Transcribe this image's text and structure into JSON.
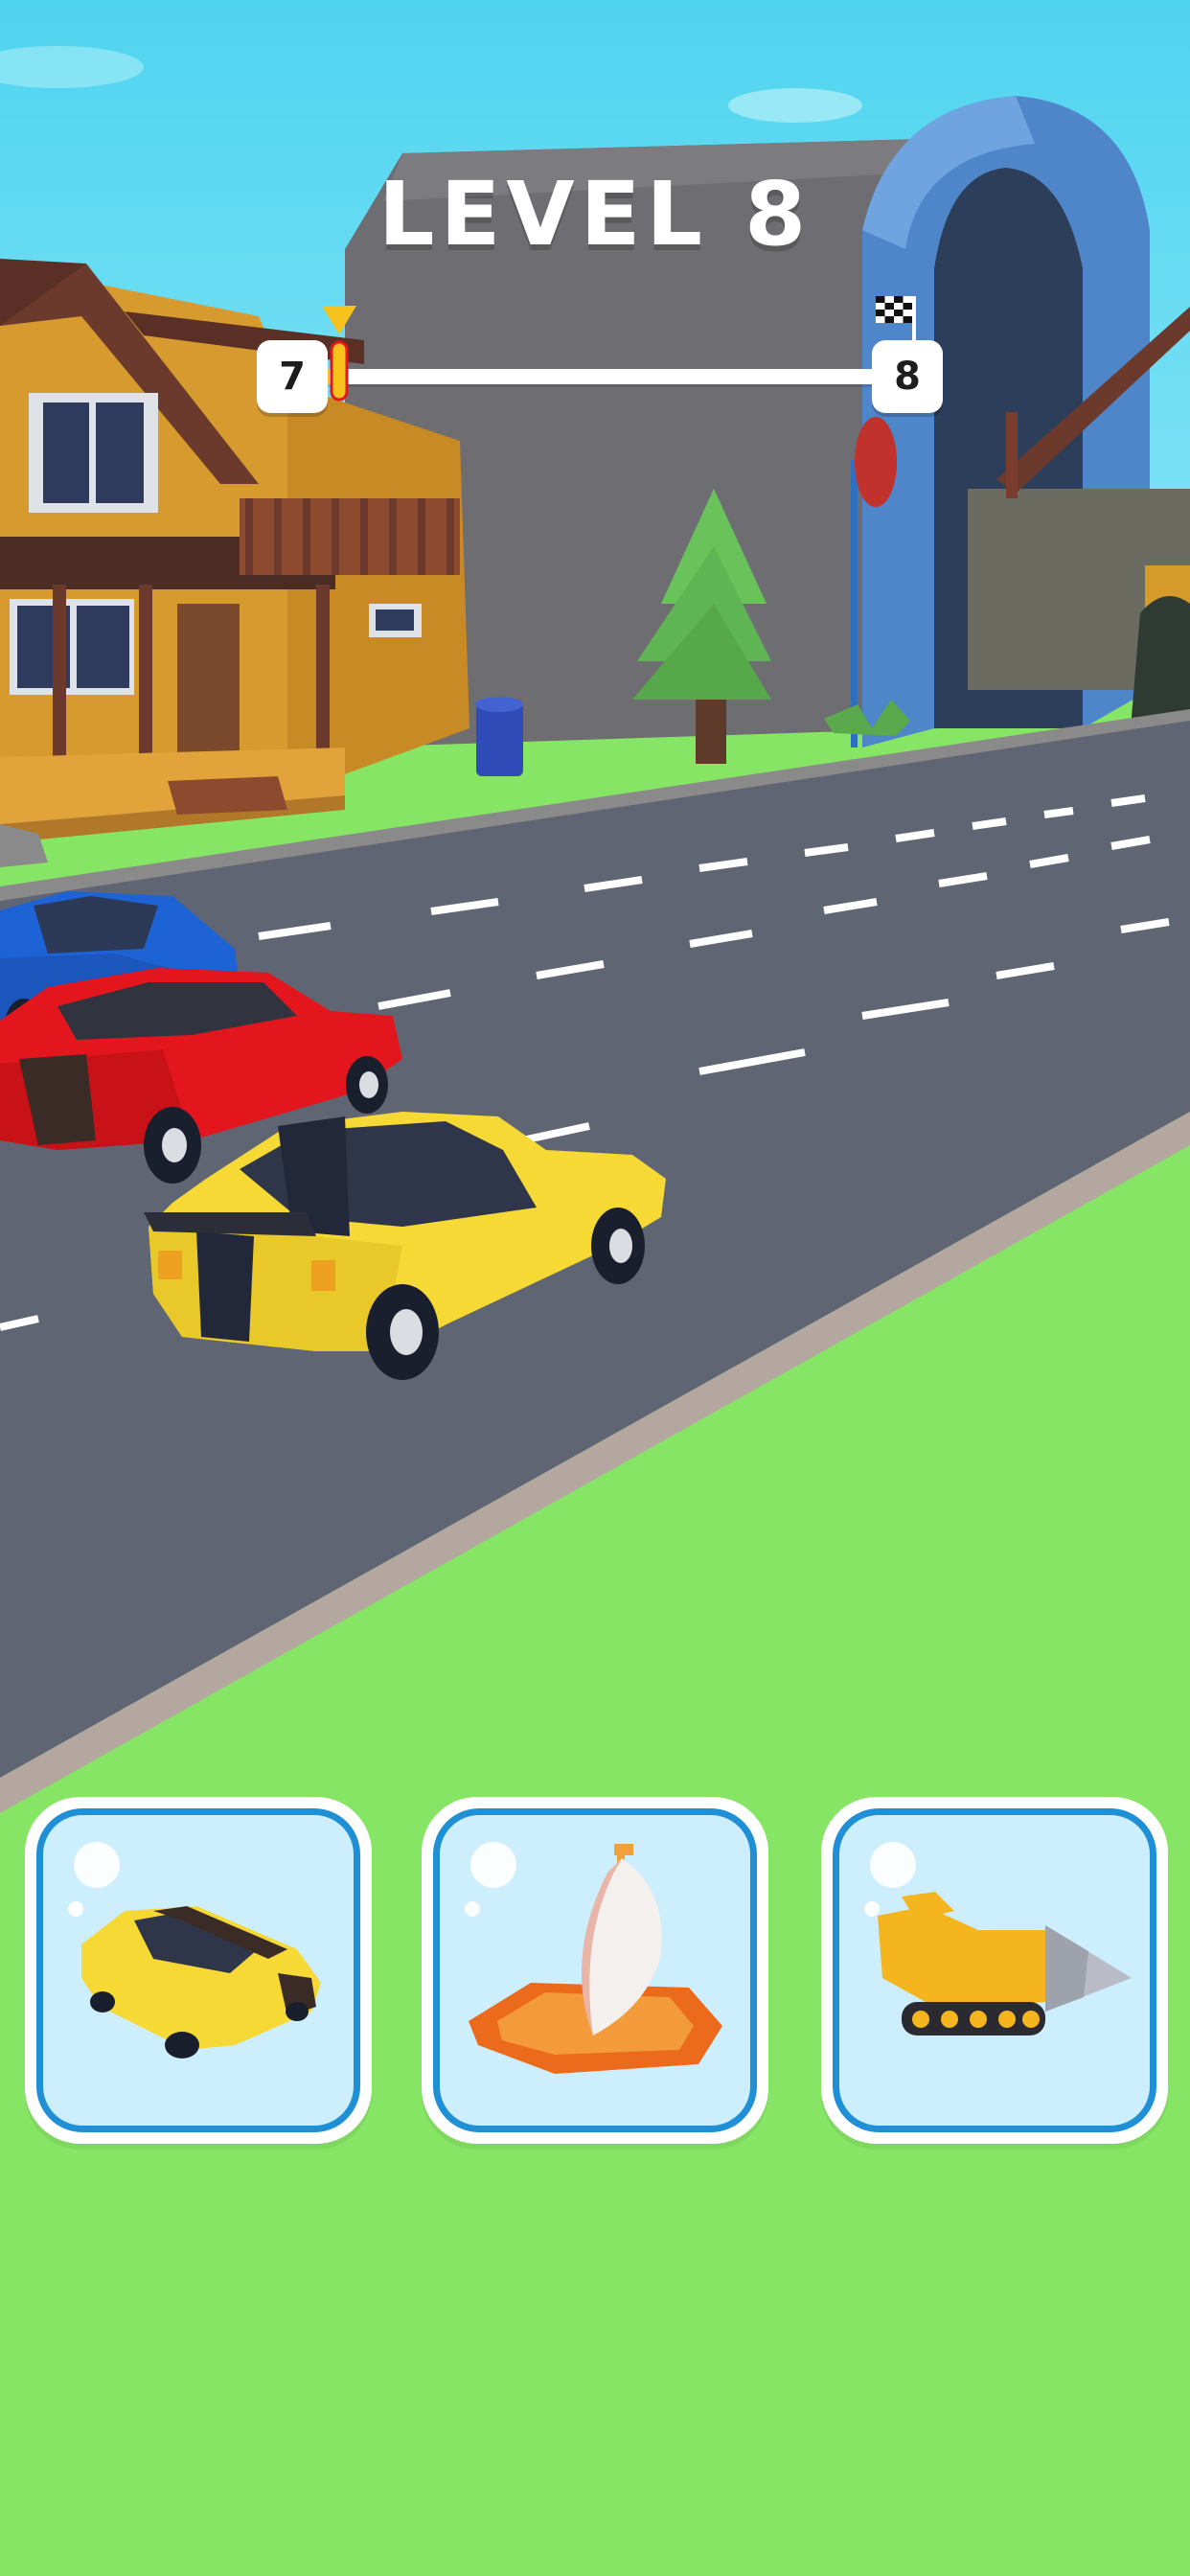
{
  "hud": {
    "level_title": "LEVEL 8",
    "progress": {
      "current_level": "7",
      "next_level": "8",
      "progress_fraction": 0.02,
      "marker_color": "#f7c21b",
      "finish_icon": "checkered-flag-icon"
    }
  },
  "vehicle_choices": [
    {
      "name": "car",
      "icon": "car-icon"
    },
    {
      "name": "boat",
      "icon": "sailboat-icon"
    },
    {
      "name": "drill",
      "icon": "drill-tank-icon"
    }
  ],
  "colors": {
    "sky": "#5ad8f0",
    "grass": "#87e565",
    "road": "#5f6572",
    "card_border": "#1f8fd6",
    "card_fill": "#cdeefc",
    "player_car": "#f7d935"
  }
}
